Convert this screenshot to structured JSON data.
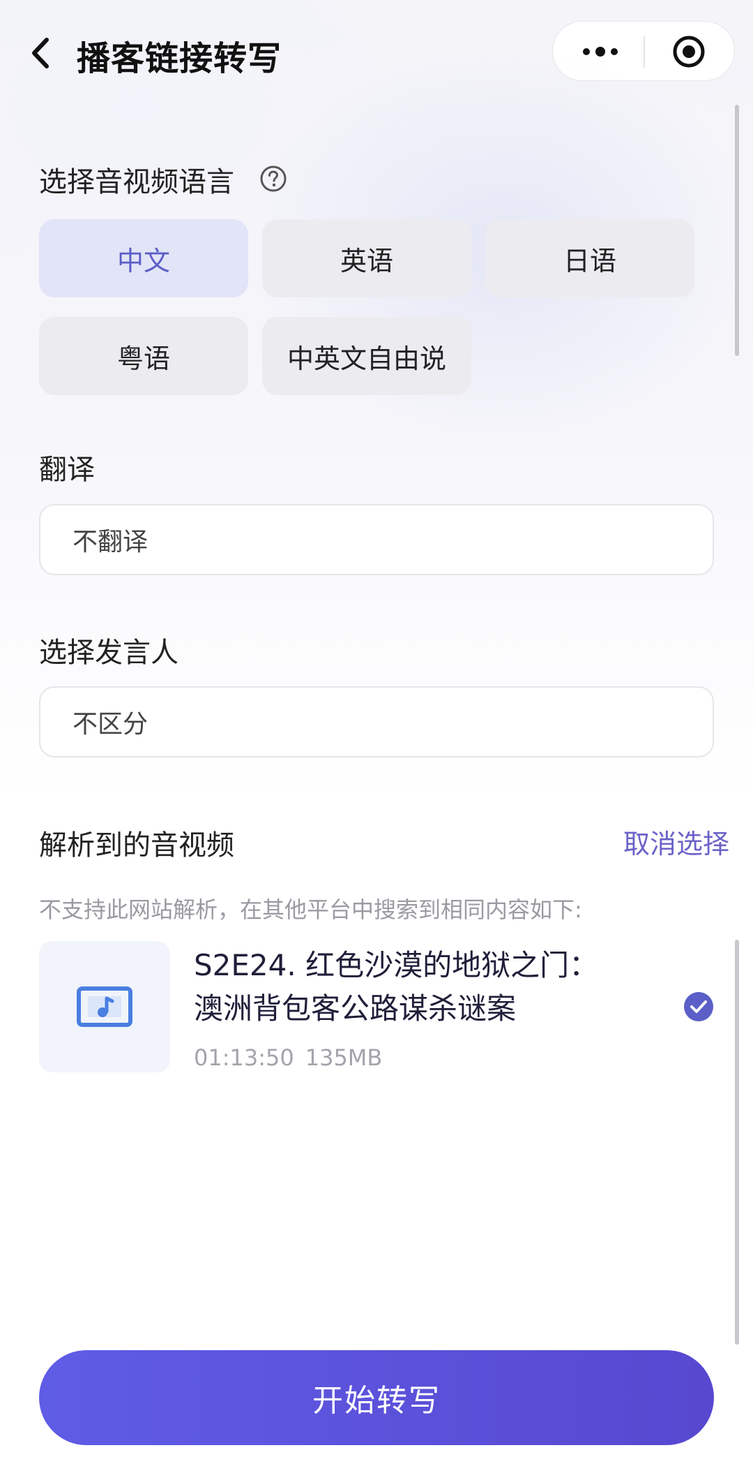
{
  "header": {
    "title": "播客链接转写",
    "back_icon": "chevron-left-icon",
    "more_icon": "more-dots-icon",
    "target_icon": "record-target-icon"
  },
  "language": {
    "label": "选择音视频语言",
    "help_icon": "question-circle-icon",
    "options": [
      {
        "label": "中文",
        "selected": true
      },
      {
        "label": "英语",
        "selected": false
      },
      {
        "label": "日语",
        "selected": false
      },
      {
        "label": "粤语",
        "selected": false
      },
      {
        "label": "中英文自由说",
        "selected": false
      }
    ]
  },
  "translate": {
    "label": "翻译",
    "value": "不翻译"
  },
  "speaker": {
    "label": "选择发言人",
    "value": "不区分"
  },
  "media": {
    "label": "解析到的音视频",
    "cancel_label": "取消选择",
    "hint": "不支持此网站解析，在其他平台中搜索到相同内容如下:",
    "item": {
      "icon": "music-file-icon",
      "title": "S2E24. 红色沙漠的地狱之门：澳洲背包客公路谋杀谜案",
      "duration": "01:13:50",
      "size": "135MB",
      "selected": true
    }
  },
  "start_button": {
    "label": "开始转写"
  },
  "colors": {
    "accent": "#5b5fc7",
    "button_start": "#5f5ce6",
    "button_end": "#5848d0",
    "chip_bg": "#ececf0",
    "chip_selected_bg": "#e2e4f7"
  }
}
